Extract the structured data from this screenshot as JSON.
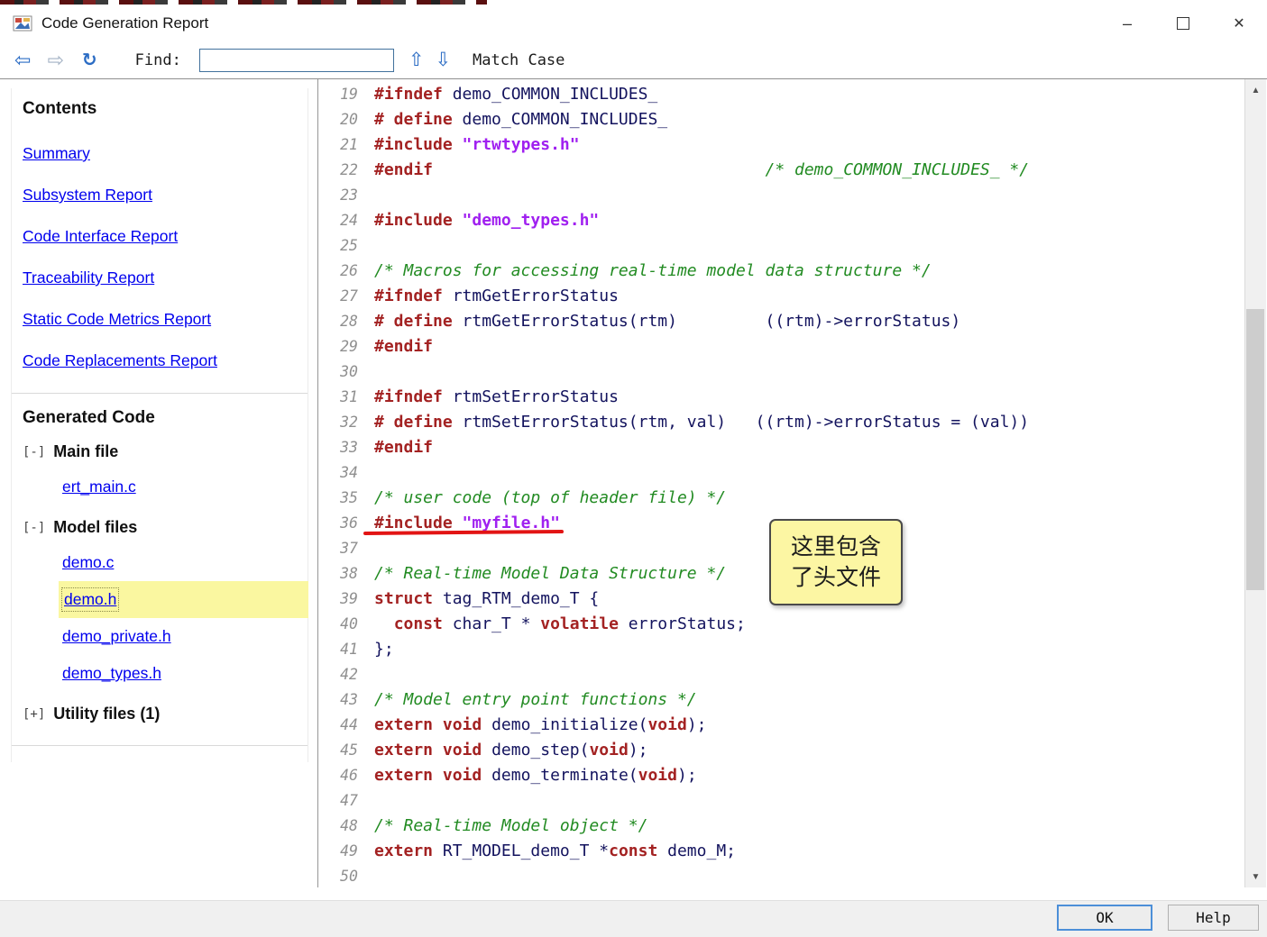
{
  "window": {
    "title": "Code Generation Report",
    "minimize_icon": "–",
    "close_icon": "✕"
  },
  "toolbar": {
    "back_icon": "⇦",
    "forward_icon": "⇨",
    "refresh_icon": "↻",
    "find_label": "Find:",
    "find_value": "",
    "find_prev_icon": "⇧",
    "find_next_icon": "⇩",
    "match_case_label": "Match Case"
  },
  "sidebar": {
    "contents_heading": "Contents",
    "links": [
      "Summary",
      "Subsystem Report",
      "Code Interface Report",
      "Traceability Report",
      "Static Code Metrics Report",
      "Code Replacements Report"
    ],
    "generated_code_heading": "Generated Code",
    "tree": [
      {
        "toggle": "[-]",
        "label": "Main file",
        "items": [
          {
            "label": "ert_main.c",
            "selected": false
          }
        ]
      },
      {
        "toggle": "[-]",
        "label": "Model files",
        "items": [
          {
            "label": "demo.c",
            "selected": false
          },
          {
            "label": "demo.h",
            "selected": true
          },
          {
            "label": "demo_private.h",
            "selected": false
          },
          {
            "label": "demo_types.h",
            "selected": false
          }
        ]
      },
      {
        "toggle": "[+]",
        "label": "Utility files (1)",
        "items": []
      }
    ]
  },
  "code": {
    "lines": [
      {
        "n": 19,
        "s": [
          [
            "k",
            "#ifndef"
          ],
          [
            "p",
            " demo_COMMON_INCLUDES_"
          ]
        ]
      },
      {
        "n": 20,
        "s": [
          [
            "k",
            "# define"
          ],
          [
            "p",
            " demo_COMMON_INCLUDES_"
          ]
        ]
      },
      {
        "n": 21,
        "s": [
          [
            "k",
            "#include"
          ],
          [
            "p",
            " "
          ],
          [
            "s",
            "\"rtwtypes.h\""
          ]
        ]
      },
      {
        "n": 22,
        "s": [
          [
            "k",
            "#endif"
          ],
          [
            "p",
            "                                  "
          ],
          [
            "c",
            "/* demo_COMMON_INCLUDES_ */"
          ]
        ]
      },
      {
        "n": 23,
        "s": []
      },
      {
        "n": 24,
        "s": [
          [
            "k",
            "#include"
          ],
          [
            "p",
            " "
          ],
          [
            "s",
            "\"demo_types.h\""
          ]
        ]
      },
      {
        "n": 25,
        "s": []
      },
      {
        "n": 26,
        "s": [
          [
            "c",
            "/* Macros for accessing real-time model data structure */"
          ]
        ]
      },
      {
        "n": 27,
        "s": [
          [
            "k",
            "#ifndef"
          ],
          [
            "p",
            " rtmGetErrorStatus"
          ]
        ]
      },
      {
        "n": 28,
        "s": [
          [
            "k",
            "# define"
          ],
          [
            "p",
            " rtmGetErrorStatus(rtm)         ((rtm)->errorStatus)"
          ]
        ]
      },
      {
        "n": 29,
        "s": [
          [
            "k",
            "#endif"
          ]
        ]
      },
      {
        "n": 30,
        "s": []
      },
      {
        "n": 31,
        "s": [
          [
            "k",
            "#ifndef"
          ],
          [
            "p",
            " rtmSetErrorStatus"
          ]
        ]
      },
      {
        "n": 32,
        "s": [
          [
            "k",
            "# define"
          ],
          [
            "p",
            " rtmSetErrorStatus(rtm, val)   ((rtm)->errorStatus = (val))"
          ]
        ]
      },
      {
        "n": 33,
        "s": [
          [
            "k",
            "#endif"
          ]
        ]
      },
      {
        "n": 34,
        "s": []
      },
      {
        "n": 35,
        "s": [
          [
            "c",
            "/* user code (top of header file) */"
          ]
        ]
      },
      {
        "n": 36,
        "s": [
          [
            "k",
            "#include"
          ],
          [
            "p",
            " "
          ],
          [
            "s",
            "\"myfile.h\""
          ]
        ]
      },
      {
        "n": 37,
        "s": []
      },
      {
        "n": 38,
        "s": [
          [
            "c",
            "/* Real-time Model Data Structure */"
          ]
        ]
      },
      {
        "n": 39,
        "s": [
          [
            "k",
            "struct"
          ],
          [
            "p",
            " tag_RTM_demo_T {"
          ]
        ]
      },
      {
        "n": 40,
        "s": [
          [
            "p",
            "  "
          ],
          [
            "k",
            "const"
          ],
          [
            "p",
            " char_T * "
          ],
          [
            "k",
            "volatile"
          ],
          [
            "p",
            " errorStatus;"
          ]
        ]
      },
      {
        "n": 41,
        "s": [
          [
            "p",
            "};"
          ]
        ]
      },
      {
        "n": 42,
        "s": []
      },
      {
        "n": 43,
        "s": [
          [
            "c",
            "/* Model entry point functions */"
          ]
        ]
      },
      {
        "n": 44,
        "s": [
          [
            "k",
            "extern"
          ],
          [
            "p",
            " "
          ],
          [
            "k",
            "void"
          ],
          [
            "p",
            " demo_initialize("
          ],
          [
            "k",
            "void"
          ],
          [
            "p",
            ");"
          ]
        ]
      },
      {
        "n": 45,
        "s": [
          [
            "k",
            "extern"
          ],
          [
            "p",
            " "
          ],
          [
            "k",
            "void"
          ],
          [
            "p",
            " demo_step("
          ],
          [
            "k",
            "void"
          ],
          [
            "p",
            ");"
          ]
        ]
      },
      {
        "n": 46,
        "s": [
          [
            "k",
            "extern"
          ],
          [
            "p",
            " "
          ],
          [
            "k",
            "void"
          ],
          [
            "p",
            " demo_terminate("
          ],
          [
            "k",
            "void"
          ],
          [
            "p",
            ");"
          ]
        ]
      },
      {
        "n": 47,
        "s": []
      },
      {
        "n": 48,
        "s": [
          [
            "c",
            "/* Real-time Model object */"
          ]
        ]
      },
      {
        "n": 49,
        "s": [
          [
            "k",
            "extern"
          ],
          [
            "p",
            " RT_MODEL_demo_T *"
          ],
          [
            "k",
            "const"
          ],
          [
            "p",
            " demo_M;"
          ]
        ]
      },
      {
        "n": 50,
        "s": []
      }
    ]
  },
  "annotation": {
    "line1": "这里包含",
    "line2": "了头文件"
  },
  "scrollbar": {
    "up_icon": "▲",
    "down_icon": "▼"
  },
  "footer": {
    "ok_label": "OK",
    "help_label": "Help"
  }
}
